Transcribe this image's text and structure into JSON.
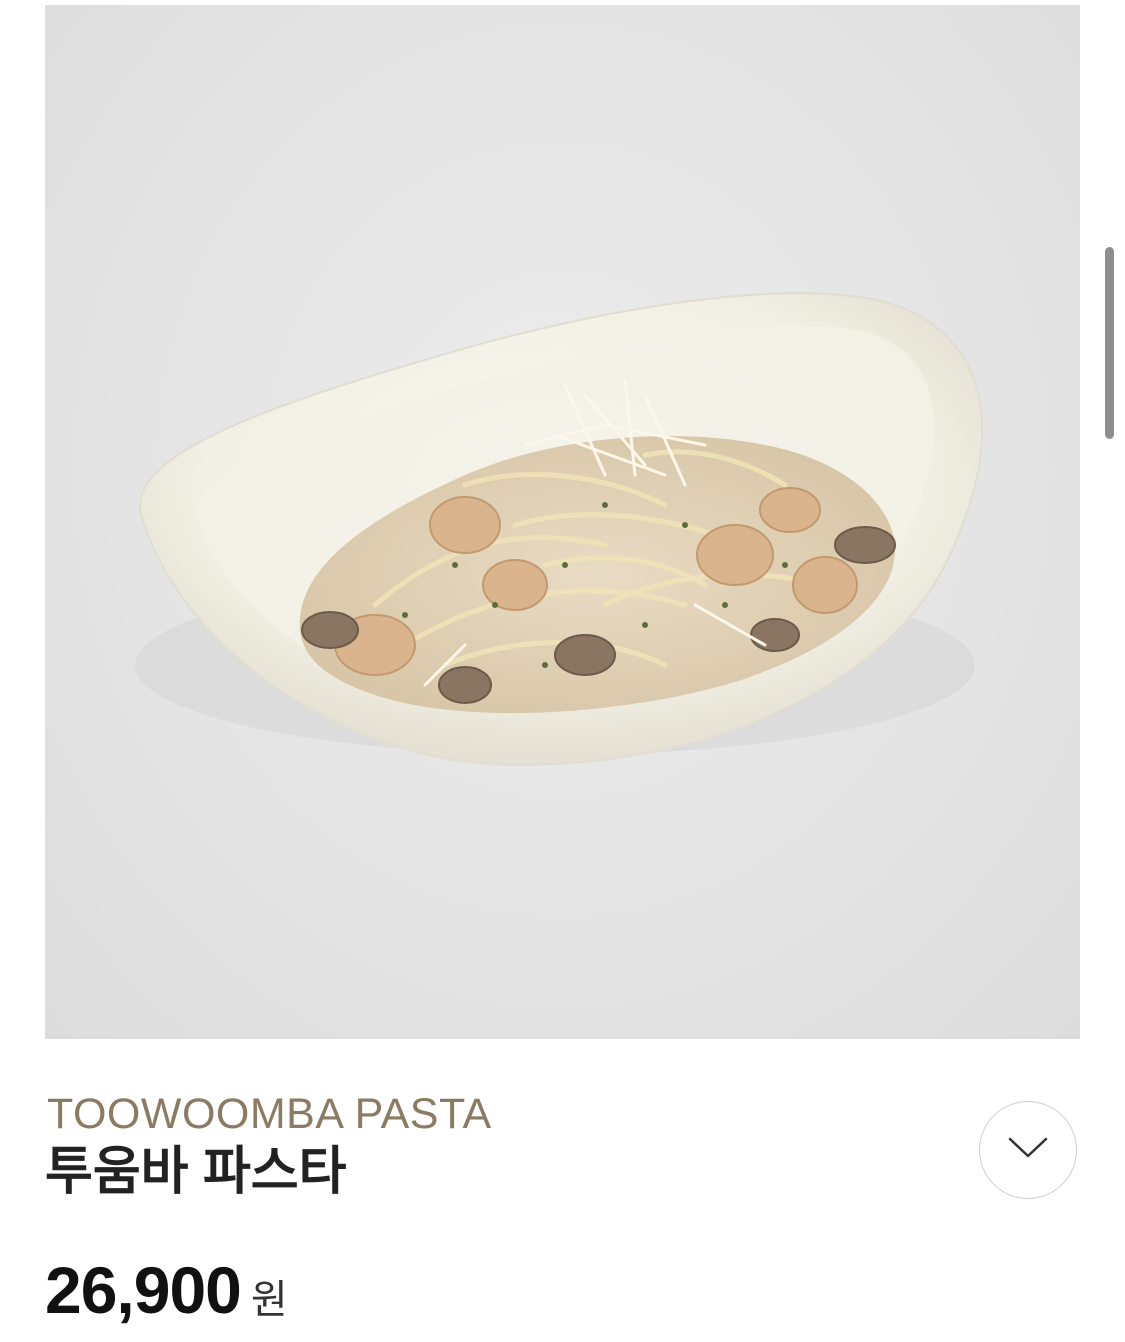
{
  "product": {
    "name_en": "TOOWOOMBA PASTA",
    "name_ko": "투움바 파스타",
    "price_value": "26,900",
    "price_unit": "원",
    "image_alt": "투움바 파스타"
  },
  "icons": {
    "expand": "chevron-down-icon"
  },
  "colors": {
    "name_en": "#8b7b62",
    "name_ko": "#222222",
    "price": "#111111",
    "photo_background": "#e6e6e6",
    "scrollbar": "#8e8e8e"
  }
}
